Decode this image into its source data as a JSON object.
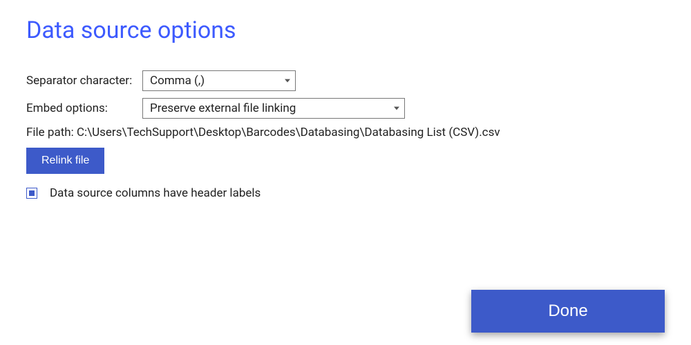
{
  "title": "Data source options",
  "separator": {
    "label": "Separator character:",
    "value": "Comma (,)"
  },
  "embed": {
    "label": "Embed options:",
    "value": "Preserve external file linking"
  },
  "filepath": {
    "label": "File path: ",
    "value": "C:\\Users\\TechSupport\\Desktop\\Barcodes\\Databasing\\Databasing List (CSV).csv"
  },
  "relink_label": "Relink file",
  "checkbox": {
    "checked": true,
    "label": "Data source columns have header labels"
  },
  "done_label": "Done"
}
